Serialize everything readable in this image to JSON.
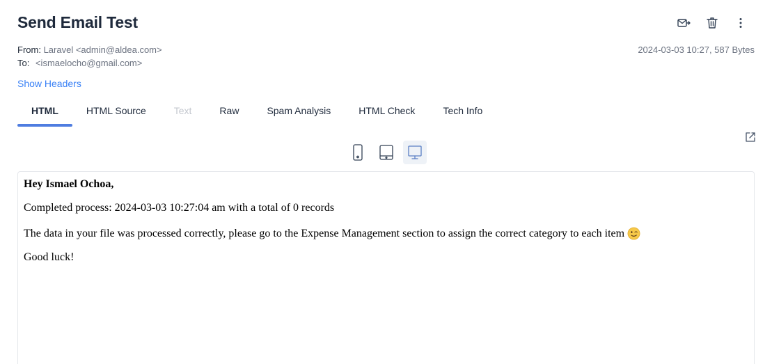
{
  "email": {
    "subject": "Send Email Test",
    "from_label": "From:",
    "from_value": "Laravel <admin@aldea.com>",
    "to_label": "To:",
    "to_value": "<ismaelocho@gmail.com>",
    "date_size": "2024-03-03 10:27, 587 Bytes",
    "show_headers": "Show Headers"
  },
  "toolbar": {
    "icons": [
      "mark-read-icon",
      "trash-icon",
      "more-vertical-icon"
    ]
  },
  "tabs": [
    {
      "label": "HTML",
      "state": "active"
    },
    {
      "label": "HTML Source",
      "state": "normal"
    },
    {
      "label": "Text",
      "state": "disabled"
    },
    {
      "label": "Raw",
      "state": "normal"
    },
    {
      "label": "Spam Analysis",
      "state": "normal"
    },
    {
      "label": "HTML Check",
      "state": "normal"
    },
    {
      "label": "Tech Info",
      "state": "normal"
    }
  ],
  "device_toggle": {
    "options": [
      "mobile",
      "tablet",
      "desktop"
    ],
    "selected": "desktop"
  },
  "body": {
    "greeting": "Hey Ismael Ochoa,",
    "line1": "Completed process: 2024-03-03 10:27:04 am with a total of 0 records",
    "line2": "The data in your file was processed correctly, please go to the Expense Management section to assign the correct category to each item",
    "emoji": "wink-emoji",
    "closing": "Good luck!"
  },
  "colors": {
    "accent": "#4f7de0",
    "link": "#3b82f6",
    "title": "#1e293b",
    "muted": "#6b7280",
    "disabled": "#c4c8cf"
  }
}
